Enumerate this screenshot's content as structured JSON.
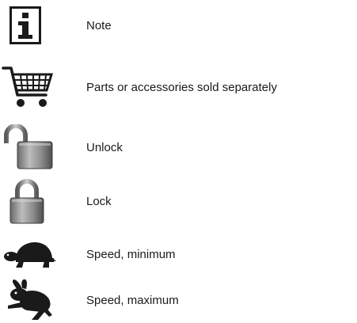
{
  "legend": {
    "items": [
      {
        "icon": "info-icon",
        "label": "Note"
      },
      {
        "icon": "shopping-cart-icon",
        "label": "Parts or accessories sold separately"
      },
      {
        "icon": "unlocked-padlock-icon",
        "label": "Unlock"
      },
      {
        "icon": "locked-padlock-icon",
        "label": "Lock"
      },
      {
        "icon": "turtle-icon",
        "label": "Speed, minimum"
      },
      {
        "icon": "rabbit-icon",
        "label": "Speed, maximum"
      }
    ]
  }
}
